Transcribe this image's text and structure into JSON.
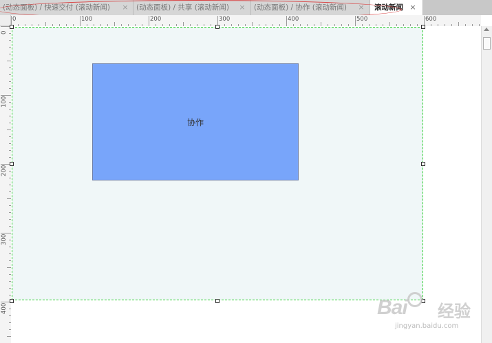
{
  "tabs": [
    {
      "label": "(动态面板) / 快速交付 (滚动新闻)",
      "active": false
    },
    {
      "label": "(动态面板) / 共享 (滚动新闻)",
      "active": false
    },
    {
      "label": "(动态面板) / 协作 (滚动新闻)",
      "active": false
    },
    {
      "label": "滚动新闻",
      "active": true
    }
  ],
  "close_glyph": "×",
  "ruler": {
    "horizontal_labels": [
      "0",
      "100",
      "200",
      "300",
      "400",
      "500",
      "600"
    ],
    "vertical_labels": [
      "0",
      "100",
      "200",
      "300",
      "400"
    ]
  },
  "canvas": {
    "widget_label": "协作",
    "panel_fill": "#f0f7f8",
    "panel_border": "#2ccf2c",
    "widget_fill": "#78a5fa"
  },
  "watermark": {
    "brand": "Bai",
    "brand_cn": "经验",
    "site": "jingyan.baidu.com"
  }
}
